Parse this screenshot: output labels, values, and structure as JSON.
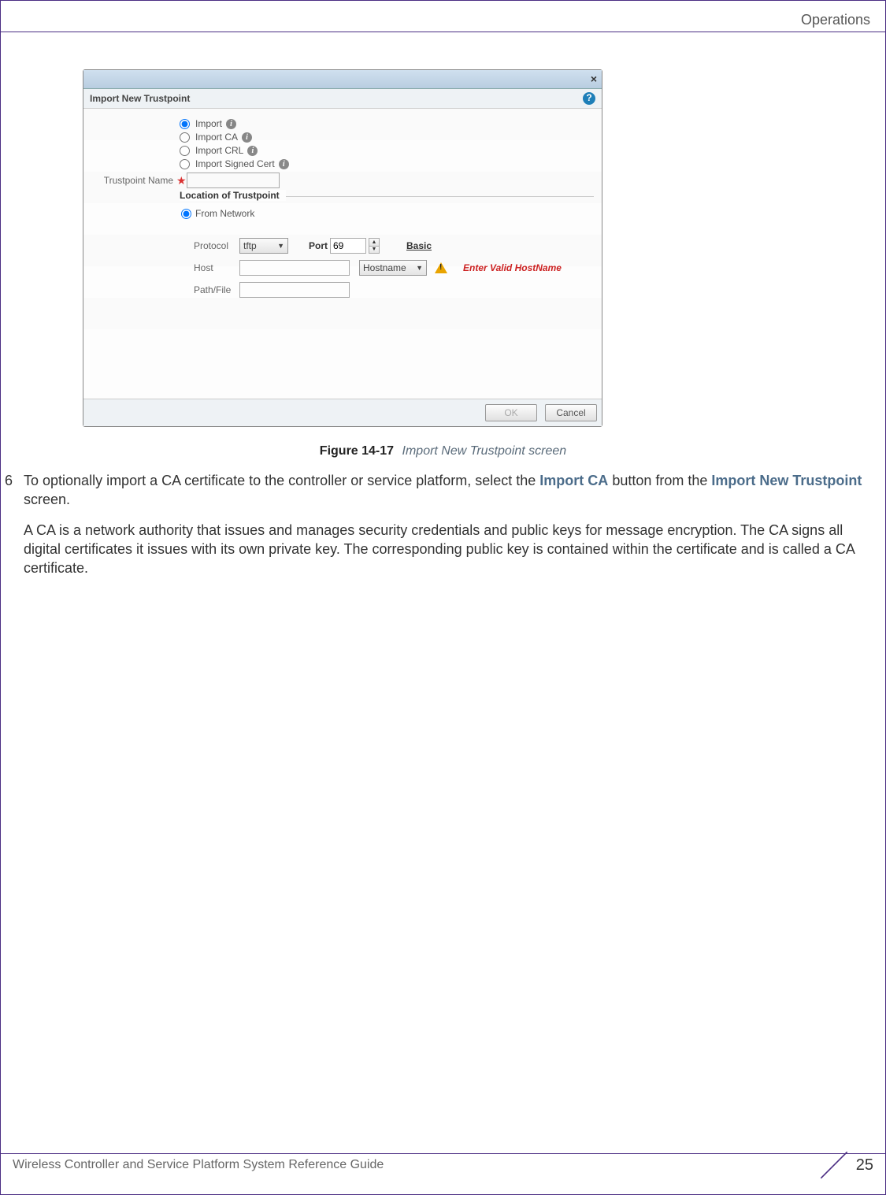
{
  "header": {
    "section": "Operations"
  },
  "dialog": {
    "title": "Import New Trustpoint",
    "close": "×",
    "help": "?",
    "radios": {
      "import": "Import",
      "import_ca": "Import CA",
      "import_crl": "Import CRL",
      "import_signed": "Import Signed Cert"
    },
    "trustpoint_name_label": "Trustpoint Name",
    "trustpoint_name_value": "",
    "location_legend": "Location of Trustpoint",
    "from_network": "From Network",
    "protocol_label": "Protocol",
    "protocol_value": "tftp",
    "port_label": "Port",
    "port_value": "69",
    "basic_link": "Basic",
    "host_label": "Host",
    "host_value": "",
    "hostname_select": "Hostname",
    "error_text": "Enter Valid HostName",
    "path_label": "Path/File",
    "path_value": "",
    "ok": "OK",
    "cancel": "Cancel"
  },
  "figure": {
    "number": "Figure 14-17",
    "caption": "Import New Trustpoint screen"
  },
  "step": {
    "num": "6",
    "part1": "To optionally import a CA certificate to the controller or service platform, select the ",
    "bold1": "Import CA",
    "part2": " button from the ",
    "bold2": "Import New Trustpoint",
    "part3": " screen.",
    "para2": "A CA is a network authority that issues and manages security credentials and public keys for message encryption. The CA signs all digital certificates it issues with its own private key. The corresponding public key is contained within the certificate and is called a CA certificate."
  },
  "footer": {
    "doc": "Wireless Controller and Service Platform System Reference Guide",
    "page": "25"
  }
}
